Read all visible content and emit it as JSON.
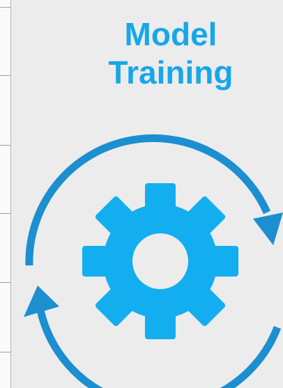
{
  "title": {
    "line1": "Model",
    "line2": "Training"
  },
  "icons": {
    "cycle": "cycle-arrows-icon",
    "gear": "gear-icon"
  },
  "colors": {
    "text": "#17a7e8",
    "cycle": "#1b8fd0",
    "gear": "#13aef0",
    "background": "#ececec"
  }
}
